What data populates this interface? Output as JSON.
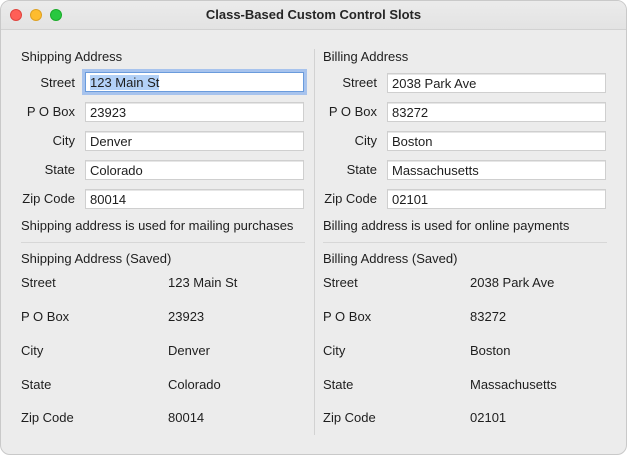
{
  "window": {
    "title": "Class-Based Custom Control Slots"
  },
  "shipping": {
    "header": "Shipping Address",
    "fields": [
      {
        "label": "Street",
        "value": "123 Main St"
      },
      {
        "label": "P O Box",
        "value": "23923"
      },
      {
        "label": "City",
        "value": "Denver"
      },
      {
        "label": "State",
        "value": "Colorado"
      },
      {
        "label": "Zip Code",
        "value": "80014"
      }
    ],
    "note": "Shipping address is used for mailing purchases",
    "saved_header": "Shipping Address (Saved)",
    "saved": [
      {
        "label": "Street",
        "value": "123 Main St"
      },
      {
        "label": "P O Box",
        "value": "23923"
      },
      {
        "label": "City",
        "value": "Denver"
      },
      {
        "label": "State",
        "value": "Colorado"
      },
      {
        "label": "Zip Code",
        "value": "80014"
      }
    ]
  },
  "billing": {
    "header": "Billing Address",
    "fields": [
      {
        "label": "Street",
        "value": "2038 Park Ave"
      },
      {
        "label": "P O Box",
        "value": "83272"
      },
      {
        "label": "City",
        "value": "Boston"
      },
      {
        "label": "State",
        "value": "Massachusetts"
      },
      {
        "label": "Zip Code",
        "value": "02101"
      }
    ],
    "note": "Billing address is used for online payments",
    "saved_header": "Billing Address (Saved)",
    "saved": [
      {
        "label": "Street",
        "value": "2038 Park Ave"
      },
      {
        "label": "P O Box",
        "value": "83272"
      },
      {
        "label": "City",
        "value": "Boston"
      },
      {
        "label": "State",
        "value": "Massachusetts"
      },
      {
        "label": "Zip Code",
        "value": "02101"
      }
    ]
  }
}
